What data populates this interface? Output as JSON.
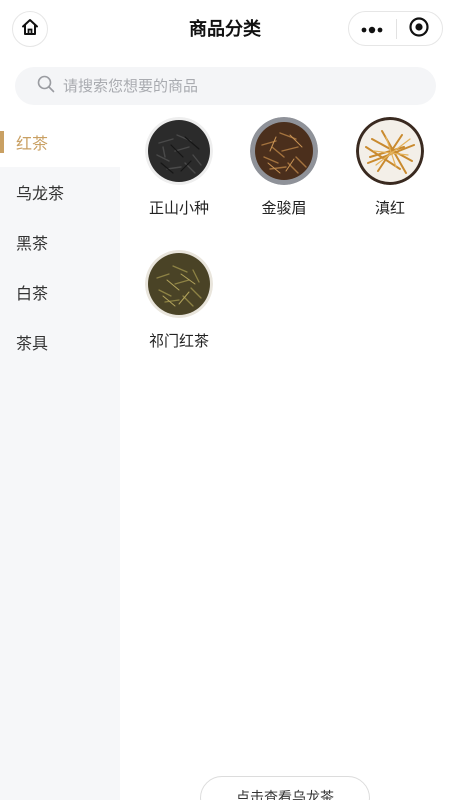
{
  "header": {
    "title": "商品分类"
  },
  "search": {
    "placeholder": "请搜索您想要的商品"
  },
  "sidebar": {
    "items": [
      {
        "label": "红茶",
        "active": true
      },
      {
        "label": "乌龙茶",
        "active": false
      },
      {
        "label": "黑茶",
        "active": false
      },
      {
        "label": "白茶",
        "active": false
      },
      {
        "label": "茶具",
        "active": false
      }
    ]
  },
  "products": [
    {
      "name": "正山小种",
      "icon": "black-tea-leaves"
    },
    {
      "name": "金骏眉",
      "icon": "golden-tea-leaves"
    },
    {
      "name": "滇红",
      "icon": "dianhong-tea-leaves"
    },
    {
      "name": "祁门红茶",
      "icon": "keemun-tea-leaves"
    }
  ],
  "footer": {
    "next_category_label": "点击查看乌龙茶"
  },
  "colors": {
    "accent": "#c9a063",
    "sidebar_bg": "#f6f7f9",
    "search_bg": "#f4f5f7"
  }
}
